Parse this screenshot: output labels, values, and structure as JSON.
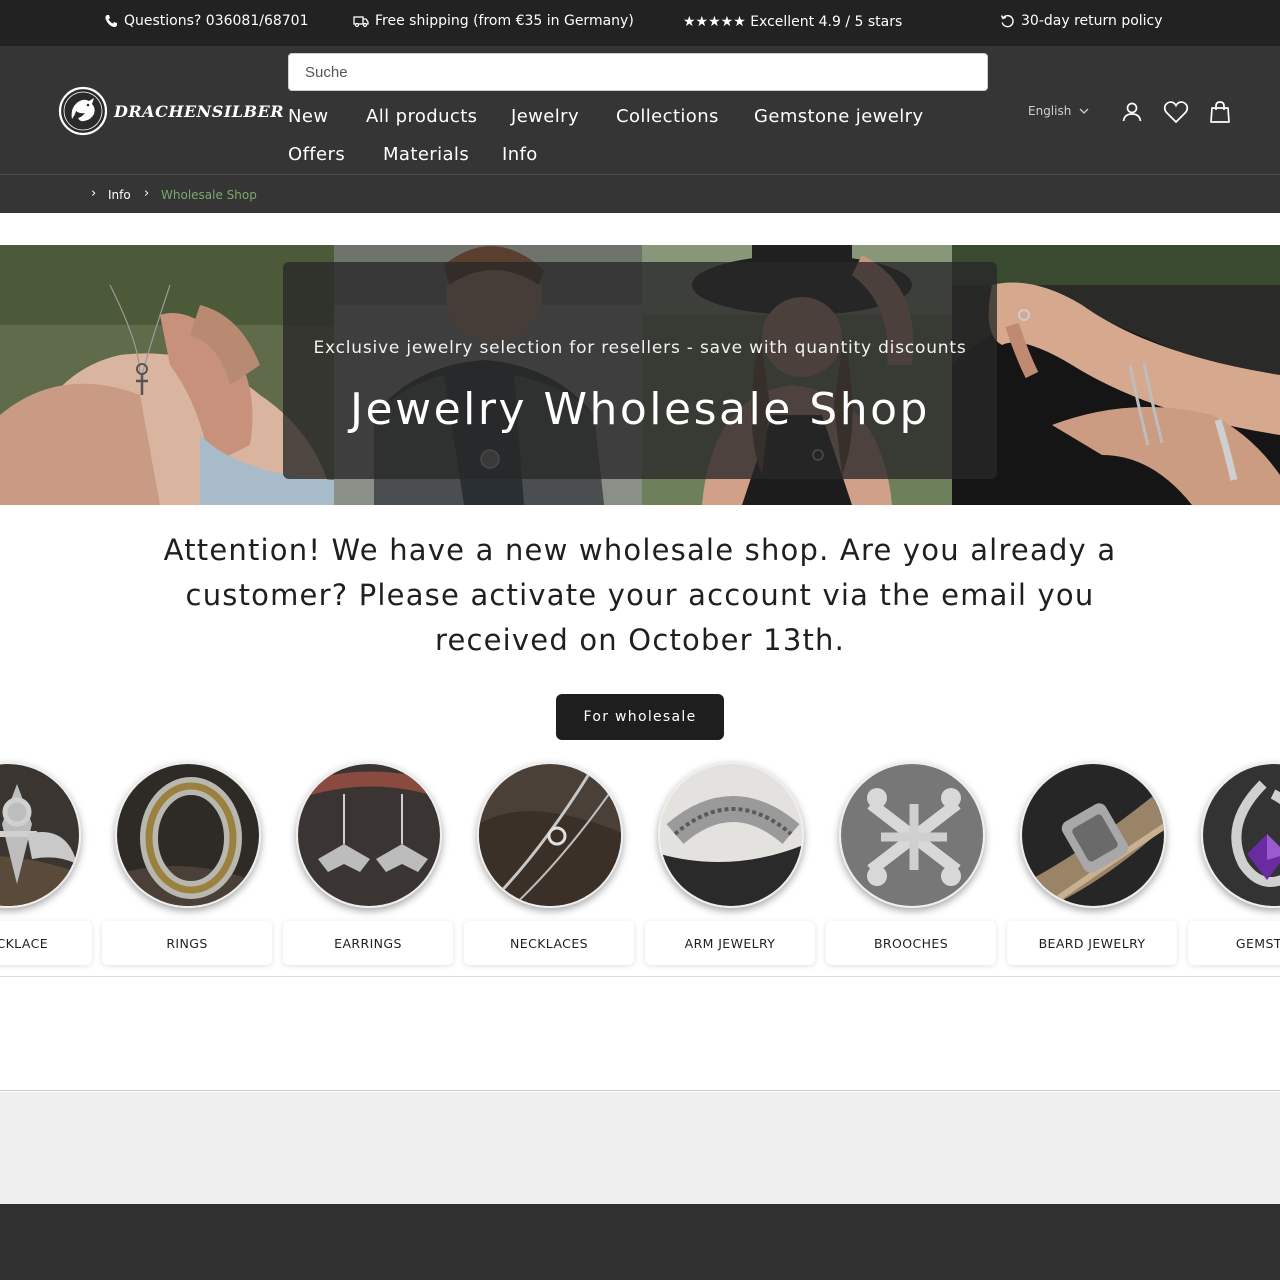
{
  "announcement_bar": {
    "phone": "Questions? 036081/68701",
    "shipping": "Free shipping (from €35 in Germany) ir",
    "rating": "★★★★★ Excellent 4.9 / 5 stars",
    "returns": "30-day return policy"
  },
  "header": {
    "logo_text": "DRACHENSILBER",
    "search_placeholder": "Suche",
    "nav": [
      "New",
      "All products",
      "Jewelry",
      "Collections",
      "Gemstone jewelry",
      "Offers",
      "Materials",
      "Info"
    ],
    "language": "English",
    "icons": [
      "account-icon",
      "wishlist-heart-icon",
      "cart-bag-icon"
    ]
  },
  "breadcrumb": [
    "Info",
    "Wholesale Shop"
  ],
  "hero": {
    "subtitle": "Exclusive jewelry selection for resellers - save with quantity discounts",
    "title": "Jewelry Wholesale Shop"
  },
  "notice": "Attention! We have a new wholesale shop. Are you already a customer? Please activate your account via the email you received on October 13th.",
  "cta_label": "For wholesale",
  "categories": [
    {
      "label": "T NECKLACE",
      "icon": "ankh-pendant-image"
    },
    {
      "label": "RINGS",
      "icon": "ring-image"
    },
    {
      "label": "EARRINGS",
      "icon": "bat-earrings-image"
    },
    {
      "label": "NECKLACES",
      "icon": "chain-necklace-image"
    },
    {
      "label": "ARM JEWELRY",
      "icon": "bangle-image"
    },
    {
      "label": "BROOCHES",
      "icon": "celtic-brooch-image"
    },
    {
      "label": "BEARD JEWELRY",
      "icon": "beard-bead-image"
    },
    {
      "label": "GEMSTONE",
      "icon": "amethyst-pendant-image"
    }
  ],
  "colors": {
    "topbar": "#222222",
    "header": "#353535",
    "breadcrumb_active": "#7aa86a",
    "cta": "#1e1e1e",
    "footer": "#303030"
  }
}
